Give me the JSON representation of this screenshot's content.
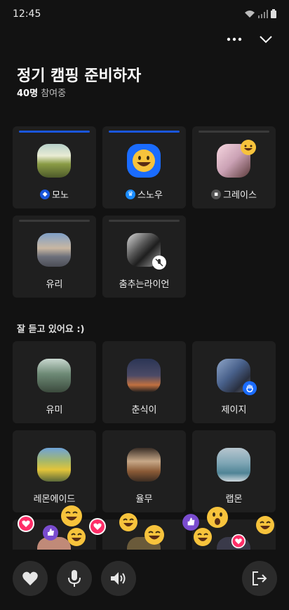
{
  "status": {
    "time": "12:45"
  },
  "room": {
    "title": "정기 캠핑 준비하자",
    "count": "40명",
    "participating": "참여중"
  },
  "speakers": [
    {
      "name": "모노",
      "badge": "host",
      "active": true
    },
    {
      "name": "스노우",
      "badge": "crown",
      "active": true
    },
    {
      "name": "그레이스",
      "badge": "member",
      "active": false
    },
    {
      "name": "유리",
      "badge": "",
      "active": false
    },
    {
      "name": "춤추는라이언",
      "badge": "",
      "active": false
    }
  ],
  "listeners_header": "잘 듣고 있어요 :)",
  "listeners": [
    {
      "name": "유미"
    },
    {
      "name": "춘식이"
    },
    {
      "name": "제이지"
    },
    {
      "name": "레몬에이드"
    },
    {
      "name": "율무"
    },
    {
      "name": "랩몬"
    }
  ],
  "controls": {
    "like": "heart-icon",
    "mic": "microphone-icon",
    "speaker": "speaker-icon",
    "leave": "exit-icon"
  },
  "colors": {
    "accent": "#1a56db",
    "background": "#121212",
    "card": "#1f1f1f"
  }
}
